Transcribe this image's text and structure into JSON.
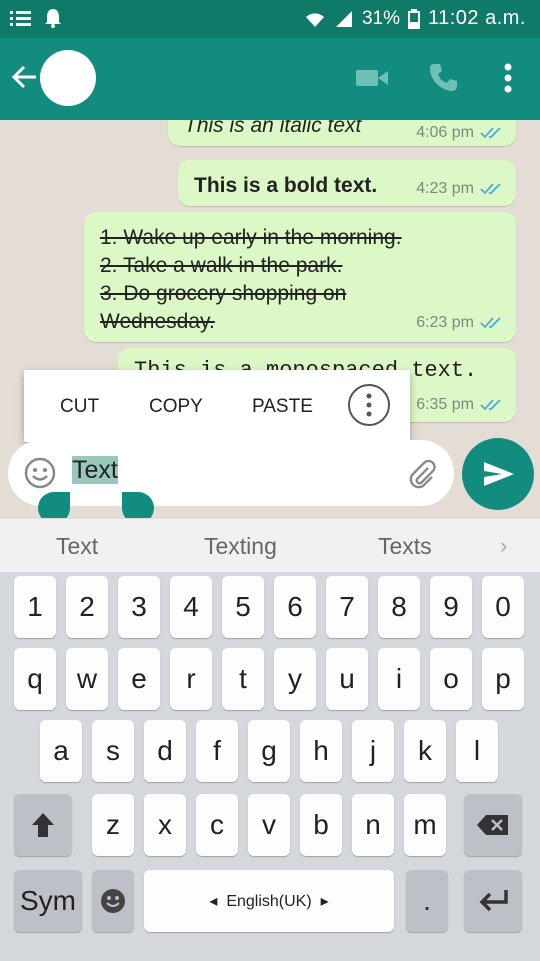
{
  "status_bar": {
    "time": "11:02 a.m.",
    "battery": "31%",
    "icons": [
      "notification-list-icon",
      "bell-icon",
      "wifi-icon",
      "signal-icon",
      "battery-icon"
    ]
  },
  "app_bar": {
    "icons": [
      "back-arrow-icon",
      "avatar",
      "video-call-icon",
      "phone-icon",
      "more-vert-icon"
    ],
    "color": "#128c7e"
  },
  "messages": [
    {
      "text": "This is an italic text",
      "time": "4:06 pm",
      "style": "italic"
    },
    {
      "text": "This is a bold text.",
      "time": "4:23 pm",
      "style": "bold"
    },
    {
      "lines": [
        "1. Wake up early in the morning.",
        "2. Take a walk in the park.",
        "3. Do grocery shopping on",
        "Wednesday."
      ],
      "time": "6:23 pm",
      "style": "strikethrough"
    },
    {
      "text": "This is a monospaced text.",
      "time": "6:35 pm",
      "style": "monospace"
    }
  ],
  "context_menu": {
    "cut": "CUT",
    "copy": "COPY",
    "paste": "PASTE"
  },
  "input": {
    "value": "Text"
  },
  "suggestions": [
    "Text",
    "Texting",
    "Texts"
  ],
  "keyboard": {
    "row1": [
      "1",
      "2",
      "3",
      "4",
      "5",
      "6",
      "7",
      "8",
      "9",
      "0"
    ],
    "row2": [
      "q",
      "w",
      "e",
      "r",
      "t",
      "y",
      "u",
      "i",
      "o",
      "p"
    ],
    "row3": [
      "a",
      "s",
      "d",
      "f",
      "g",
      "h",
      "j",
      "k",
      "l"
    ],
    "row4": [
      "z",
      "x",
      "c",
      "v",
      "b",
      "n",
      "m"
    ],
    "sym": "Sym",
    "space": "English(UK)",
    "period": "."
  },
  "colors": {
    "header": "#128c7e",
    "bubble": "#dcf8c6",
    "chat_bg": "#e4ddd5",
    "read_ticks": "#4fc3f7"
  }
}
